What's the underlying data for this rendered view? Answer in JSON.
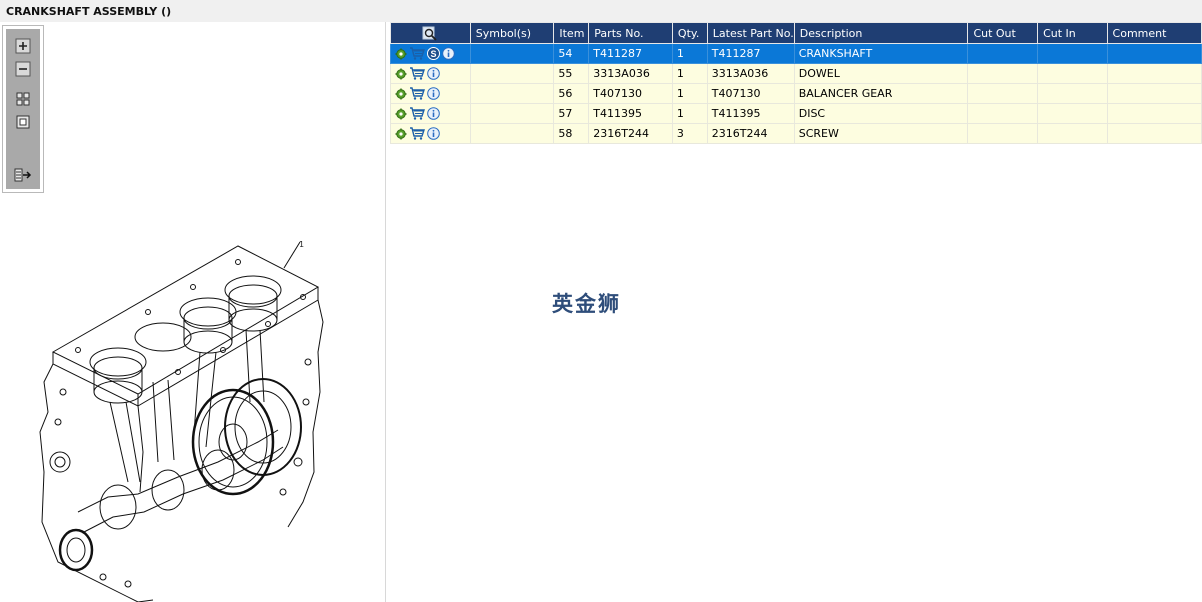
{
  "window": {
    "title": "CRANKSHAFT ASSEMBLY ()"
  },
  "toolbox": {
    "buttons": [
      {
        "name": "zoom-in-icon"
      },
      {
        "name": "zoom-out-icon"
      },
      {
        "name": "fit-grid-icon"
      },
      {
        "name": "actual-size-icon"
      },
      {
        "name": "export-icon"
      }
    ]
  },
  "drawing": {
    "callout": "1"
  },
  "table": {
    "columns": [
      "Symbol(s)",
      "Item",
      "Parts No.",
      "Qty.",
      "Latest Part No.",
      "Description",
      "Cut Out",
      "Cut In",
      "Comment"
    ],
    "header_icon": "search-parts-icon",
    "rows": [
      {
        "symbols": "",
        "item": "54",
        "part_no": "T411287",
        "qty": "1",
        "latest": "T411287",
        "description": "CRANKSHAFT",
        "cut_out": "",
        "cut_in": "",
        "comment": "",
        "selected": true,
        "has_s_badge": true
      },
      {
        "symbols": "",
        "item": "55",
        "part_no": "3313A036",
        "qty": "1",
        "latest": "3313A036",
        "description": "DOWEL",
        "cut_out": "",
        "cut_in": "",
        "comment": "",
        "selected": false,
        "has_s_badge": false
      },
      {
        "symbols": "",
        "item": "56",
        "part_no": "T407130",
        "qty": "1",
        "latest": "T407130",
        "description": "BALANCER GEAR",
        "cut_out": "",
        "cut_in": "",
        "comment": "",
        "selected": false,
        "has_s_badge": false
      },
      {
        "symbols": "",
        "item": "57",
        "part_no": "T411395",
        "qty": "1",
        "latest": "T411395",
        "description": "DISC",
        "cut_out": "",
        "cut_in": "",
        "comment": "",
        "selected": false,
        "has_s_badge": false
      },
      {
        "symbols": "",
        "item": "58",
        "part_no": "2316T244",
        "qty": "3",
        "latest": "2316T244",
        "description": "SCREW",
        "cut_out": "",
        "cut_in": "",
        "comment": "",
        "selected": false,
        "has_s_badge": false
      }
    ]
  },
  "watermark": "英金狮",
  "colors": {
    "header": "#1f3e73",
    "selected_row": "#0b78d7",
    "row_bg": "#fdfde0",
    "watermark": "#2e4d7a"
  }
}
